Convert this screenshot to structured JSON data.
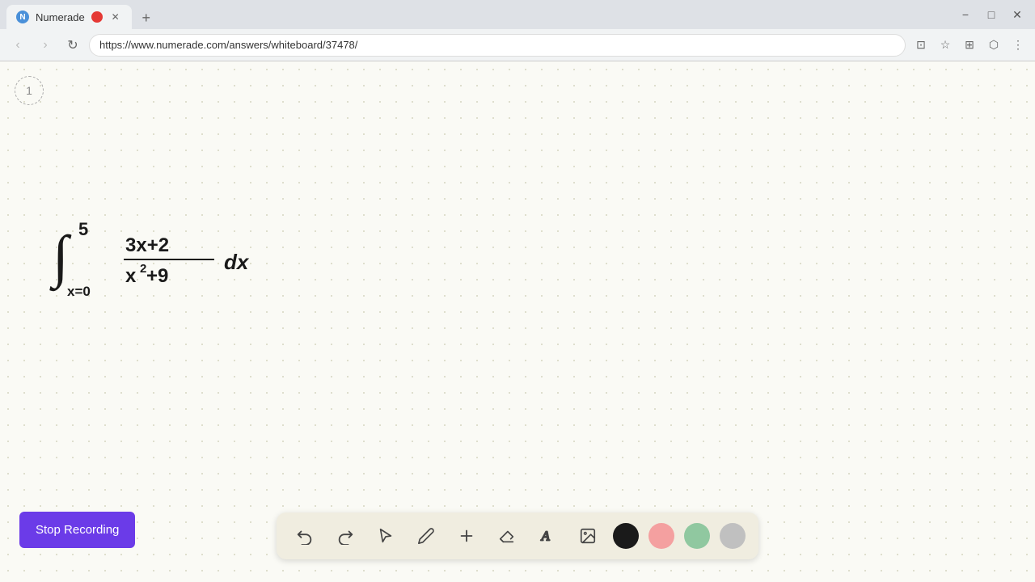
{
  "browser": {
    "tab": {
      "title": "Numerade",
      "favicon_letter": "N",
      "favicon_color": "#4a90d9"
    },
    "url": "https://www.numerade.com/answers/whiteboard/37478/",
    "window_controls": {
      "minimize": "−",
      "maximize": "□",
      "close": "✕"
    }
  },
  "toolbar": {
    "tools": [
      {
        "name": "undo",
        "label": "↩"
      },
      {
        "name": "redo",
        "label": "↪"
      },
      {
        "name": "select",
        "label": "▶"
      },
      {
        "name": "pencil",
        "label": "✏"
      },
      {
        "name": "add",
        "label": "+"
      },
      {
        "name": "eraser",
        "label": "◻"
      },
      {
        "name": "text",
        "label": "A"
      },
      {
        "name": "image",
        "label": "🖼"
      }
    ],
    "colors": [
      {
        "name": "black",
        "hex": "#1a1a1a"
      },
      {
        "name": "pink",
        "hex": "#f4a0a0"
      },
      {
        "name": "green",
        "hex": "#90c8a0"
      },
      {
        "name": "gray",
        "hex": "#c0c0c0"
      }
    ]
  },
  "page_number": "1",
  "stop_recording_label": "Stop Recording",
  "math_formula": "∫ from x=0 to 5 of (3x+2)/(x²+9) dx"
}
